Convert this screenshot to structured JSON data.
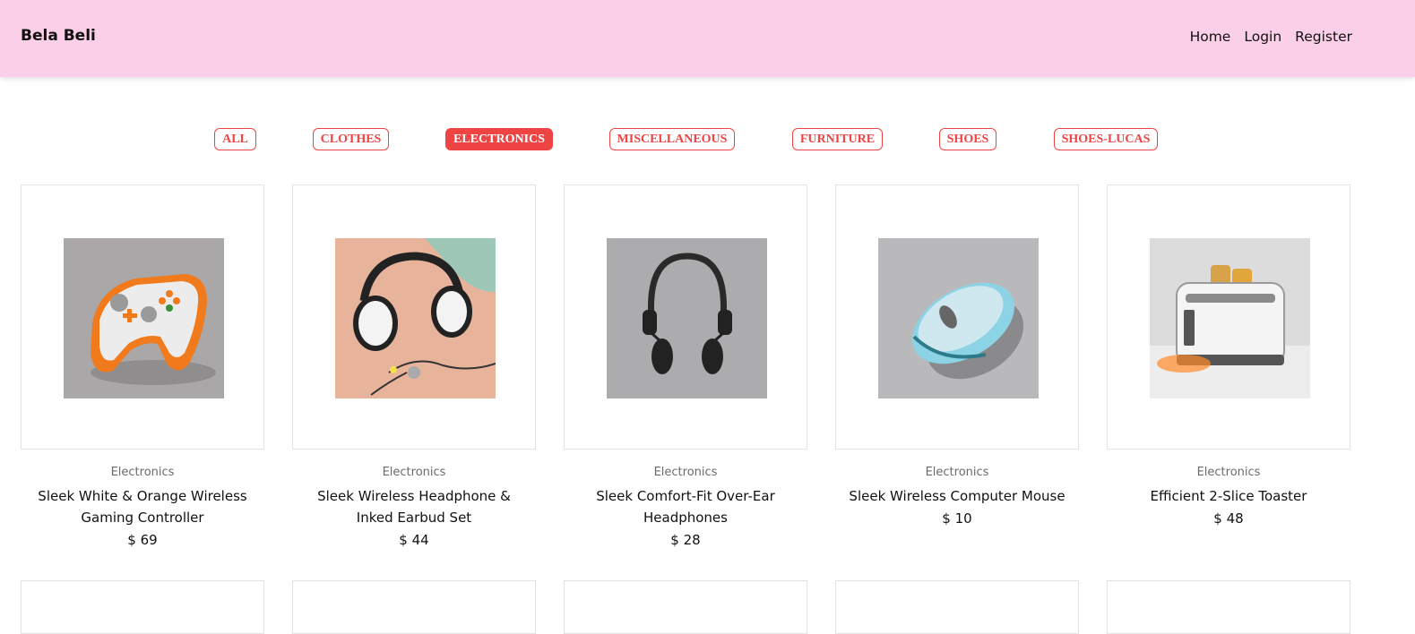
{
  "brand": "Bela Beli",
  "nav": {
    "home": "Home",
    "login": "Login",
    "register": "Register"
  },
  "categories": {
    "all": "ALL",
    "clothes": "CLOTHES",
    "electronics": "ELECTRONICS",
    "miscellaneous": "MISCELLANEOUS",
    "furniture": "FURNITURE",
    "shoes": "SHOES",
    "shoes_lucas": "SHOES-LUCAS",
    "active": "ELECTRONICS"
  },
  "products": [
    {
      "category": "Electronics",
      "title": "Sleek White & Orange Wireless Gaming Controller",
      "price": "$ 69",
      "icon": "gaming-controller-image"
    },
    {
      "category": "Electronics",
      "title": "Sleek Wireless Headphone & Inked Earbud Set",
      "price": "$ 44",
      "icon": "headphones-earbuds-image"
    },
    {
      "category": "Electronics",
      "title": "Sleek Comfort-Fit Over-Ear Headphones",
      "price": "$ 28",
      "icon": "over-ear-headphones-image"
    },
    {
      "category": "Electronics",
      "title": "Sleek Wireless Computer Mouse",
      "price": "$ 10",
      "icon": "computer-mouse-image"
    },
    {
      "category": "Electronics",
      "title": "Efficient 2-Slice Toaster",
      "price": "$ 48",
      "icon": "toaster-image"
    }
  ],
  "colors": {
    "navbar": "#fbcfe8",
    "accent": "#ef4444"
  }
}
